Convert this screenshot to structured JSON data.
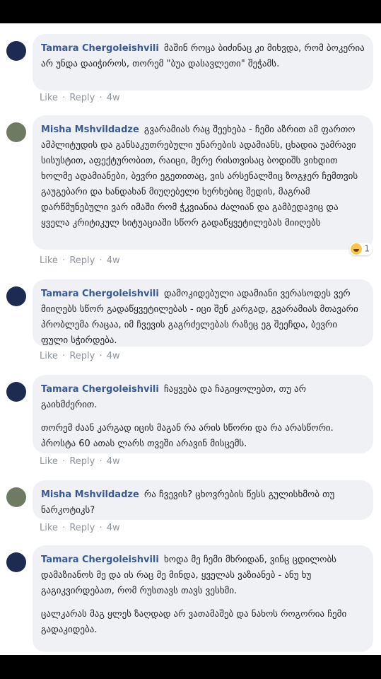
{
  "actions": {
    "like": "Like",
    "reply": "Reply",
    "sep": "·"
  },
  "comments": [
    {
      "author": "Tamara Chergoleishvili",
      "paragraphs": [
        "მაშინ როცა ბიძინაც კი მიხვდა, რომ ბოკერია არ უნდა დაიჭიროს, თორემ \"ბუა დასავლეთი\" შეჭამს."
      ],
      "time": "4w"
    },
    {
      "author": "Misha Mshvildadze",
      "paragraphs": [
        "გვარამიას რაც შეეხება - ჩემი აზრით ამ ფართო ამპლიტუდის და განსაკუთრებული უნარების ადამიანს, ცხადია უამრავი სისუსტით, აფექტურობით, რაიცი, მერე რისთვისაც ბოდიშს ვიხდით ხოლმე ადამიანები, ბევრი ეგეთითაც, ვის არსენალშიც ზოგჯერ ჩემთვის გაუგებარი და ხანდახან მიუღებელი ხერხებიც შედის, მაგრამ დარწმუნებული ვარ იმაში რომ ჭკვიანია ძალიან და გამბედავიც და ყველა კრიტიკულ სიტუაციაში სწორ გადაწყვეტილებას მიიღებს"
      ],
      "time": "4w",
      "reaction_count": "1"
    },
    {
      "author": "Tamara Chergoleishvili",
      "paragraphs": [
        "დამოკიდებული ადამიანი ვერასოდეს ვერ მიიღებს სწორ გადაწყვეტილებას - იცი შენ კარგად, გვარამიას მთავარი პრობლემა რაცაა, იმ ჩვევის გაგრძელებას რაზეც ეგ შეეჩდა, ბევრი ფული სჭირდება."
      ],
      "time": "4w"
    },
    {
      "author": "Tamara Chergoleishvili",
      "paragraphs": [
        "ჩაყვება და ჩაგიყოლებთ, თუ არ გაიხმძერით.",
        "თორემ ძაან კარგად იცის მაგან რა არის სწორი და რა არასწორი. პროსტა 60 ათას ლარს თვეში არავინ მისცემს."
      ],
      "time": "4w"
    },
    {
      "author": "Misha Mshvildadze",
      "paragraphs": [
        "რა ჩვევის? ცხოვრების წესს გულისხმობ თუ ნარკოტიკს?"
      ],
      "time": "4w"
    },
    {
      "author": "Tamara Chergoleishvili",
      "paragraphs": [
        "ხოდა მე ჩემი მხრიდან, ვინც ცდილობს დამაზიანოს მე და ის რაც მე მინდა, ყველას ვაზიანებ - ანუ ხუ გაგიკვირდებათ, რომ რუსთავს თავს ვესხმი.",
        "ცალკარას მაგ ყლეს ზაღდად არ ვათამაშებ და ნახოს როგორია ჩემი გადაკიდება."
      ],
      "time": "4w"
    }
  ]
}
